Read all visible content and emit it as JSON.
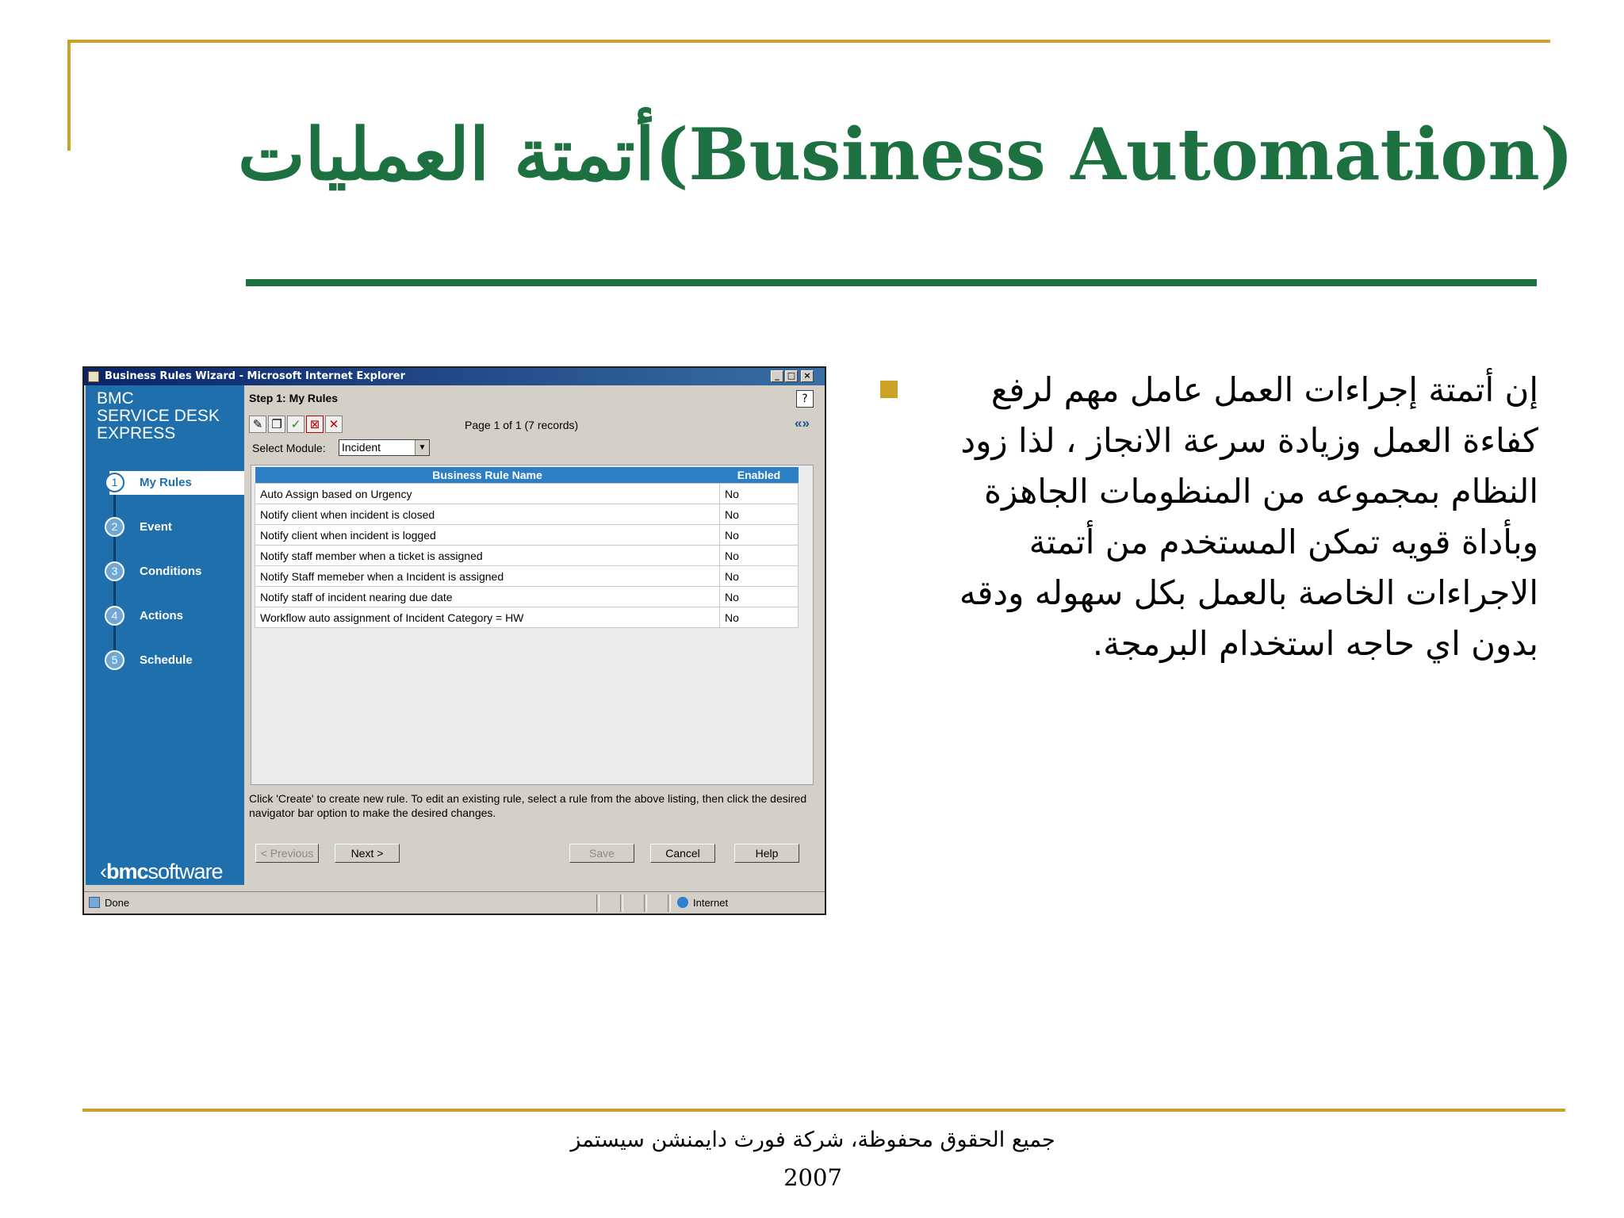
{
  "slide": {
    "title_ar": "أتمتة العمليات",
    "title_en": "(Business Automation)",
    "body_ar": "إن أتمتة إجراءات العمل عامل مهم لرفع كفاءة العمل وزيادة سرعة الانجاز ، لذا زود النظام بمجموعه من المنظومات الجاهزة وبأداة قويه تمكن المستخدم من أتمتة الاجراءات الخاصة بالعمل بكل سهوله ودقه بدون اي حاجه استخدام البرمجة.",
    "footer_ar": "جميع الحقوق محفوظة، شركة فورث دايمنشن سيستمز",
    "footer_year": "2007",
    "colors": {
      "title_green": "#1d7040",
      "accent_gold": "#c9a227"
    }
  },
  "window": {
    "title": "Business Rules Wizard - Microsoft Internet Explorer",
    "controls": {
      "minimize": "_",
      "maximize": "□",
      "close": "×"
    },
    "brand": {
      "line1": "BMC",
      "line2": "SERVICE DESK",
      "line3": "EXPRESS"
    },
    "logo": {
      "bmc": "bmc",
      "software": "software"
    },
    "steps": [
      {
        "num": "1",
        "label": "My Rules"
      },
      {
        "num": "2",
        "label": "Event"
      },
      {
        "num": "3",
        "label": "Conditions"
      },
      {
        "num": "4",
        "label": "Actions"
      },
      {
        "num": "5",
        "label": "Schedule"
      }
    ],
    "step_header": "Step 1: My Rules",
    "help_icon": "?",
    "paging": "Page 1 of 1 (7 records)",
    "paging_nav": "«»",
    "select_label": "Select Module:",
    "select_value": "Incident",
    "table": {
      "col_name": "Business Rule Name",
      "col_enabled": "Enabled",
      "rows": [
        {
          "name": "Auto Assign based on Urgency",
          "enabled": "No"
        },
        {
          "name": "Notify client when incident is closed",
          "enabled": "No"
        },
        {
          "name": "Notify client when incident is logged",
          "enabled": "No"
        },
        {
          "name": "Notify staff member when a ticket is assigned",
          "enabled": "No"
        },
        {
          "name": "Notify Staff memeber when a Incident is assigned",
          "enabled": "No"
        },
        {
          "name": "Notify staff of incident nearing due date",
          "enabled": "No"
        },
        {
          "name": "Workflow auto assignment of Incident Category = HW",
          "enabled": "No"
        }
      ]
    },
    "instructions": "Click 'Create' to create new rule. To edit an existing rule, select a rule from the above listing, then click the desired navigator bar option to make the desired changes.",
    "buttons": {
      "previous": "< Previous",
      "next": "Next >",
      "save": "Save",
      "cancel": "Cancel",
      "help": "Help"
    },
    "status": {
      "left": "Done",
      "zone": "Internet"
    }
  }
}
